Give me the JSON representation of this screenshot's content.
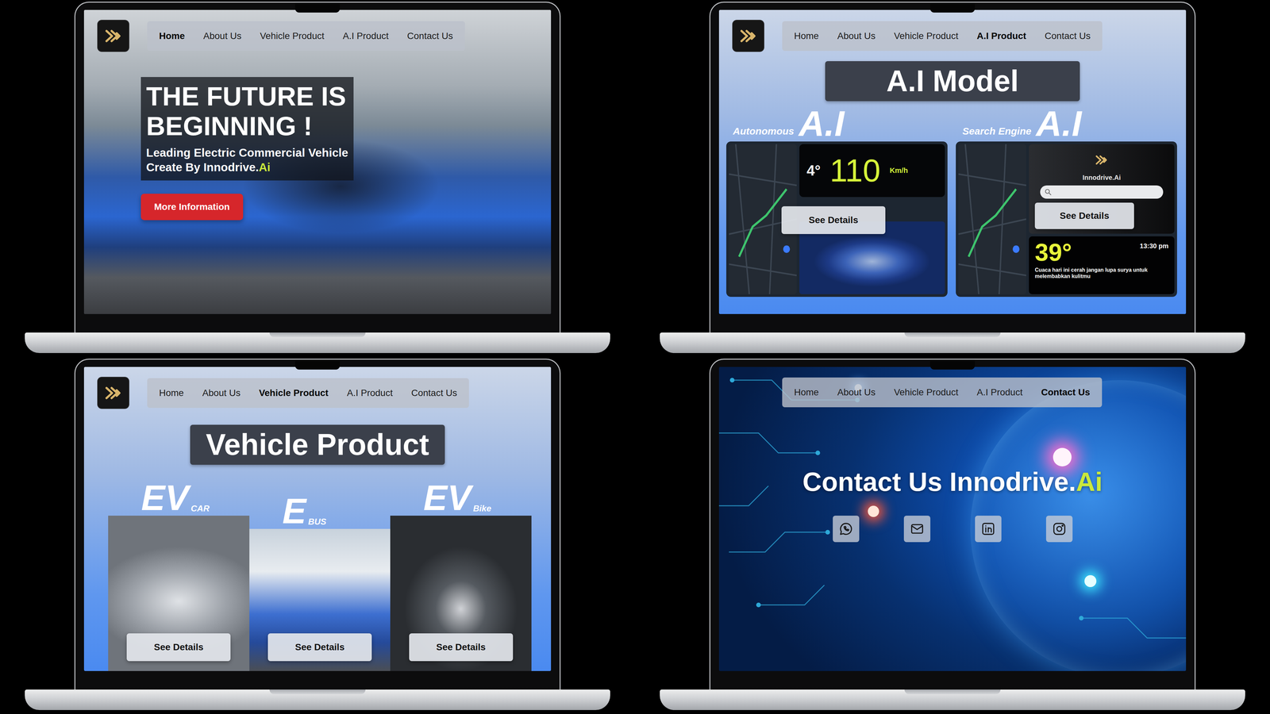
{
  "screens": [
    {
      "kind": "home",
      "logo": true,
      "nav": [
        {
          "label": "Home",
          "selected": true
        },
        {
          "label": "About Us",
          "selected": false
        },
        {
          "label": "Vehicle Product",
          "selected": false
        },
        {
          "label": "A.I Product",
          "selected": false
        },
        {
          "label": "Contact Us",
          "selected": false
        }
      ],
      "headline_lines": [
        "THE FUTURE IS",
        "BEGINNING !"
      ],
      "subtitle_lines": [
        "Leading Electric Commercial Vehicle",
        "Create By Innodrive."
      ],
      "subtitle_accent": "Ai",
      "button": "More Information"
    },
    {
      "kind": "ai",
      "logo": true,
      "nav": [
        {
          "label": "Home",
          "selected": false
        },
        {
          "label": "About Us",
          "selected": false
        },
        {
          "label": "Vehicle Product",
          "selected": false
        },
        {
          "label": "A.I Product",
          "selected": true
        },
        {
          "label": "Contact Us",
          "selected": false
        }
      ],
      "title": "A.I Model",
      "cards": [
        {
          "kind": "autonomous",
          "caption": "Autonomous",
          "badge": "A.I",
          "button": "See Details",
          "temperature": "4°",
          "speed": "110",
          "unit": "Km/h"
        },
        {
          "kind": "search",
          "caption": "Search Engine",
          "badge": "A.I",
          "button": "See Details",
          "brand": "Innodrive.Ai",
          "temperature": "39°",
          "time": "13:30 pm",
          "note": "Cuaca hari ini cerah jangan lupa surya untuk melembabkan kulitmu"
        }
      ]
    },
    {
      "kind": "vehicle",
      "logo": true,
      "nav": [
        {
          "label": "Home",
          "selected": false
        },
        {
          "label": "About Us",
          "selected": false
        },
        {
          "label": "Vehicle Product",
          "selected": true
        },
        {
          "label": "A.I Product",
          "selected": false
        },
        {
          "label": "Contact Us",
          "selected": false
        }
      ],
      "title": "Vehicle Product",
      "cards": [
        {
          "badge": "EV",
          "sub": "CAR",
          "button": "See Details"
        },
        {
          "badge": "E",
          "sub": "BUS",
          "button": "See Details"
        },
        {
          "badge": "EV",
          "sub": "Bike",
          "button": "See Details"
        }
      ]
    },
    {
      "kind": "contact",
      "logo": false,
      "nav": [
        {
          "label": "Home",
          "selected": false
        },
        {
          "label": "About Us",
          "selected": false
        },
        {
          "label": "Vehicle Product",
          "selected": false
        },
        {
          "label": "A.I Product",
          "selected": false
        },
        {
          "label": "Contact Us",
          "selected": true
        }
      ],
      "title": "Contact Us Innodrive.",
      "title_accent": "Ai",
      "socials": [
        {
          "kind": "whatsapp"
        },
        {
          "kind": "mail"
        },
        {
          "kind": "linkedin"
        },
        {
          "kind": "instagram"
        }
      ]
    }
  ]
}
